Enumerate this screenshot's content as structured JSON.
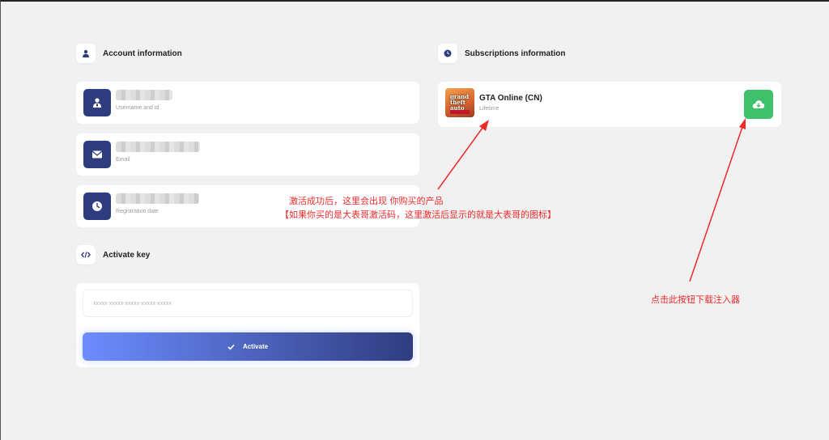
{
  "account": {
    "title": "Account information",
    "username_label": "Username and id",
    "email_label": "Email",
    "registration_label": "Registration date"
  },
  "activate": {
    "title": "Activate key",
    "placeholder": "xxxxx-xxxxx-xxxxx-xxxxx-xxxxx",
    "button_label": "Activate"
  },
  "subscriptions": {
    "title": "Subscriptions information",
    "product_name": "GTA Online (CN)",
    "product_term": "Lifetime"
  },
  "annotations": {
    "product_note_line1": "激活成功后，这里会出现 你购买的产品",
    "product_note_line2": "【如果你买的是大表哥激活码，这里激活后显示的就是大表哥的图标】",
    "download_note": "点击此按钮下载注入器"
  },
  "colors": {
    "accent": "#2f3d80",
    "download": "#3fc06b",
    "annotation": "#ee2b2b"
  }
}
